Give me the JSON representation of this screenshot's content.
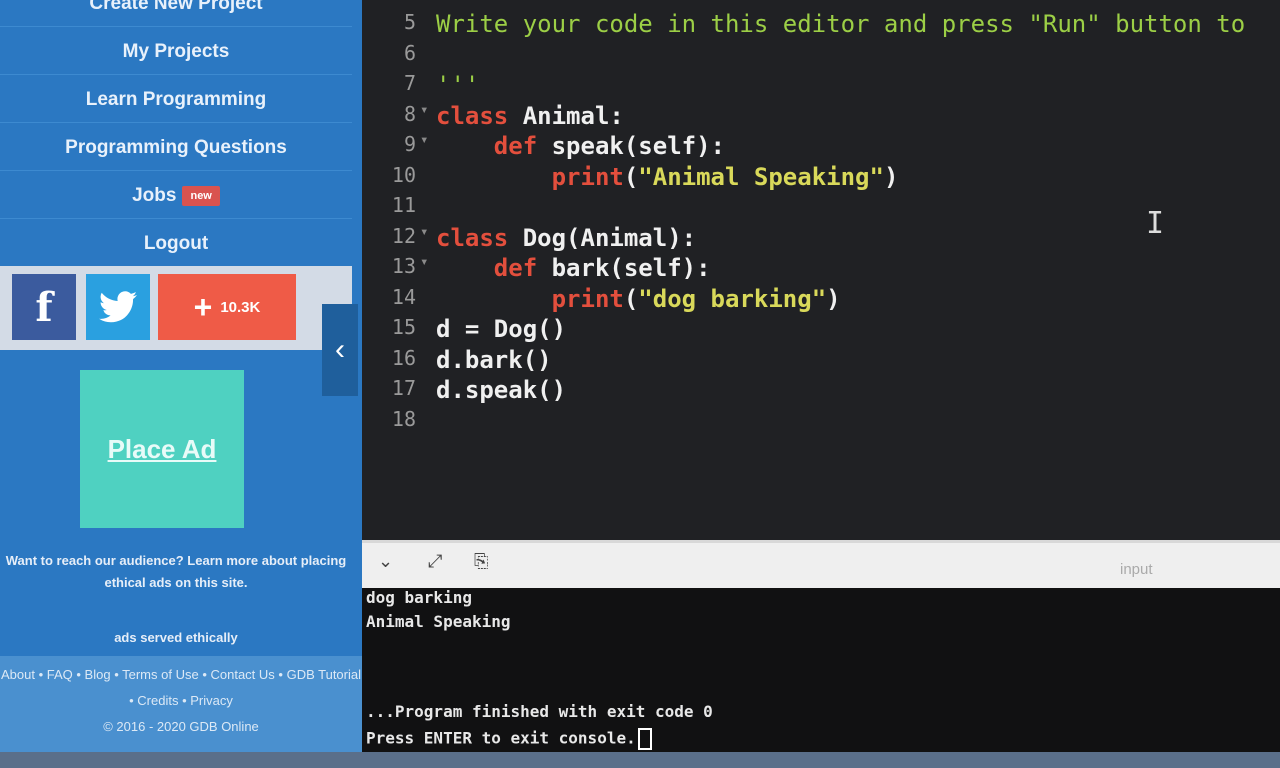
{
  "sidebar": {
    "nav": [
      {
        "label": "Create New Project"
      },
      {
        "label": "My Projects"
      },
      {
        "label": "Learn Programming"
      },
      {
        "label": "Programming Questions"
      },
      {
        "label": "Jobs",
        "badge": "new"
      },
      {
        "label": "Logout"
      }
    ],
    "social": {
      "facebook_glyph": "f",
      "share_count": "10.3K"
    },
    "ad": {
      "label": "Place Ad",
      "text": "Want to reach our audience? Learn more about placing ethical ads on this site.",
      "ethical": "ads served ethically"
    },
    "footer": {
      "links": [
        "About",
        "FAQ",
        "Blog",
        "Terms of Use",
        "Contact Us",
        "GDB Tutorial",
        "Credits",
        "Privacy"
      ],
      "copyright": "© 2016 - 2020 GDB Online"
    }
  },
  "editor": {
    "lines": [
      {
        "n": "5",
        "html": "<span class=\"cmt\">Write your code in this editor and press \"Run\" button to</span>"
      },
      {
        "n": "6",
        "html": ""
      },
      {
        "n": "7",
        "html": "<span class=\"cmt\">'''</span>"
      },
      {
        "n": "8",
        "fold": true,
        "html": "<span class=\"kw\">class</span> Animal:"
      },
      {
        "n": "9",
        "fold": true,
        "html": "    <span class=\"kw\">def</span> speak(self):"
      },
      {
        "n": "10",
        "html": "        <span class=\"kw\">print</span>(<span class=\"str\">\"Animal Speaking\"</span>)"
      },
      {
        "n": "11",
        "html": ""
      },
      {
        "n": "12",
        "fold": true,
        "html": "<span class=\"kw\">class</span> Dog(Animal):"
      },
      {
        "n": "13",
        "fold": true,
        "html": "    <span class=\"kw\">def</span> bark(self):"
      },
      {
        "n": "14",
        "html": "        <span class=\"kw\">print</span>(<span class=\"str\">\"dog barking\"</span>)"
      },
      {
        "n": "15",
        "html": "d = Dog()"
      },
      {
        "n": "16",
        "html": "d.bark()"
      },
      {
        "n": "17",
        "html": "d.speak()"
      },
      {
        "n": "18",
        "html": ""
      }
    ]
  },
  "console": {
    "input_label": "input",
    "output": [
      "dog barking",
      "Animal Speaking",
      "",
      "",
      "...Program finished with exit code 0",
      "Press ENTER to exit console."
    ]
  },
  "colors": {
    "sidebar_bg": "#2b78c2",
    "editor_bg": "#202124",
    "keyword": "#e34f3d",
    "string": "#d9d95a",
    "comment": "#9ccf46"
  }
}
